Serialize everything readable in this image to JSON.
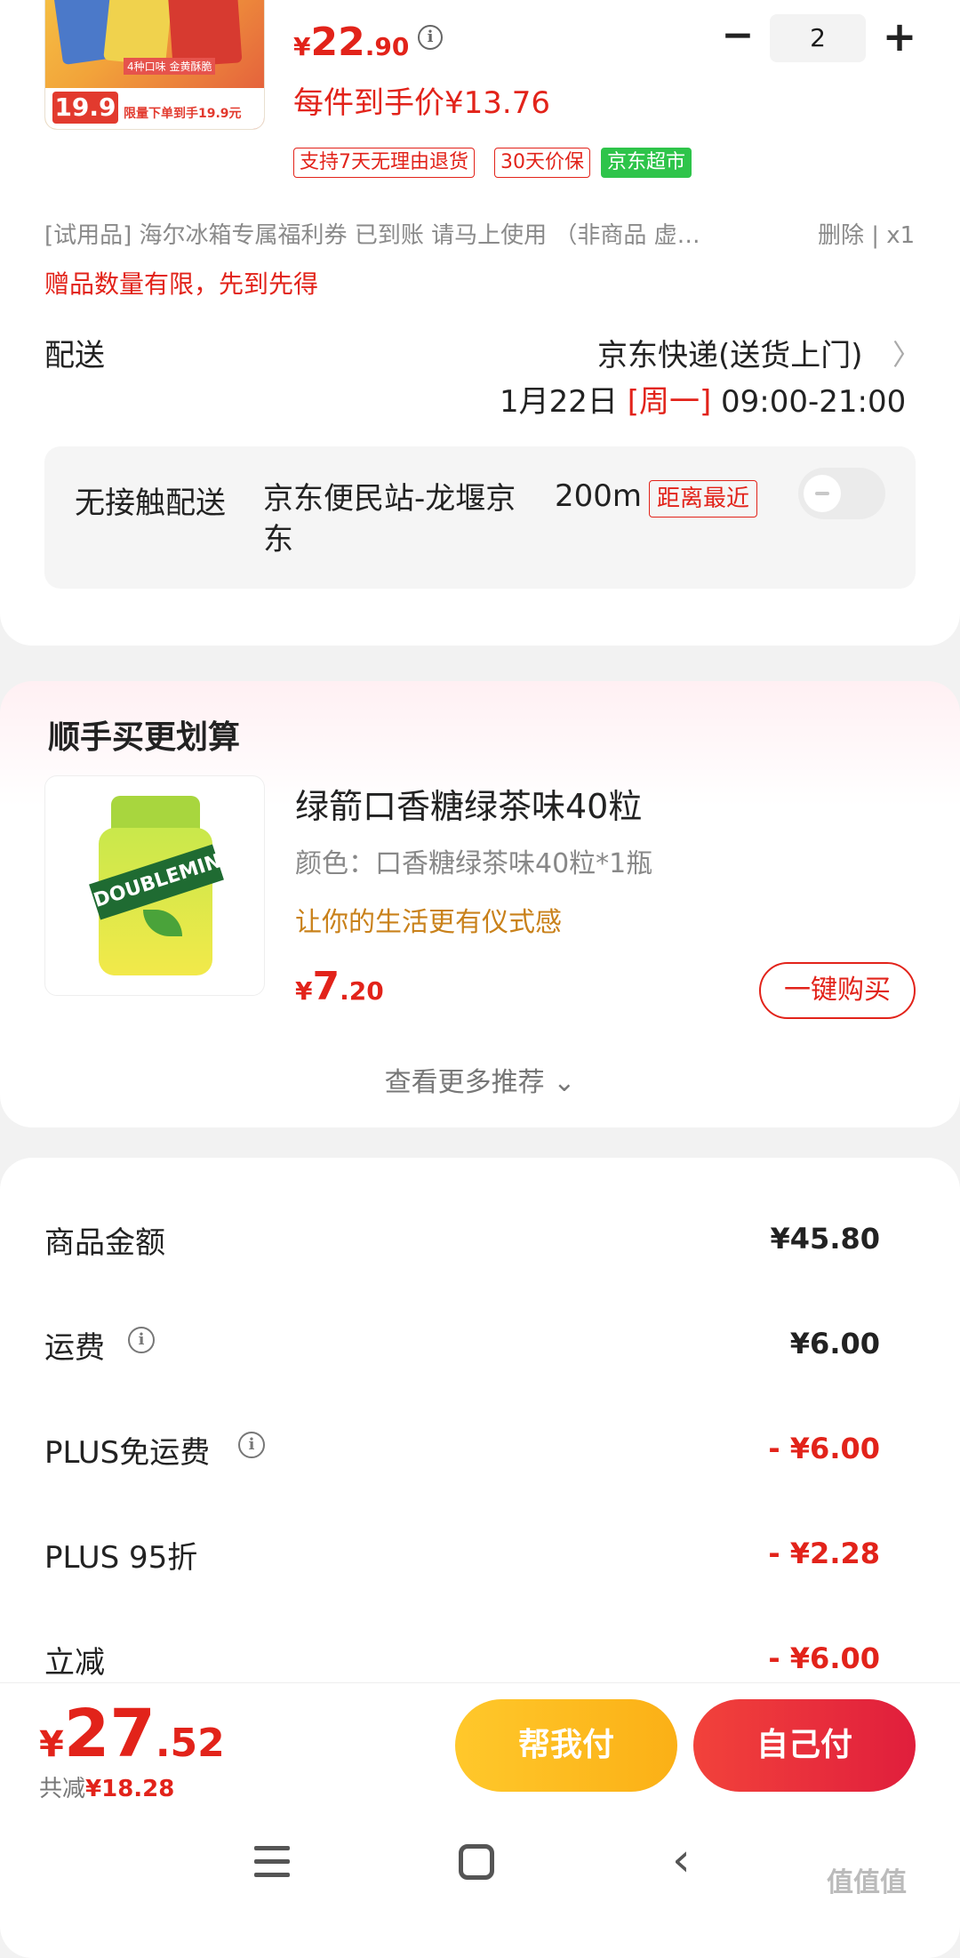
{
  "product": {
    "image_alt": "snack-pack",
    "image_price": "19.9",
    "image_promo": "限量下单到手19.9元",
    "image_strip": "4种口味 金黄酥脆",
    "price_yen": "¥",
    "price_int": "22",
    "price_dec": ".90",
    "unit_price": "每件到手价¥13.76",
    "quantity": "2",
    "tags": [
      "支持7天无理由退货",
      "30天价保",
      "京东超市"
    ]
  },
  "gift": {
    "line": "[试用品]  海尔冰箱专属福利券 已到账  请马上使用 （非商品 虚…",
    "delete": "删除 | x1",
    "note": "赠品数量有限，先到先得"
  },
  "delivery": {
    "label": "配送",
    "method": "京东快递(送货上门)",
    "date": "1月22日 ",
    "weekday": "[周一]",
    "time": " 09:00-21:00"
  },
  "contactless": {
    "title": "无接触配送",
    "station": "京东便民站-龙堰京东",
    "distance": "200m",
    "tag": "距离最近"
  },
  "recommend": {
    "title": "顺手买更划算",
    "item_name": "绿箭口香糖绿茶味40粒",
    "item_spec": "颜色：口香糖绿茶味40粒*1瓶",
    "slogan": "让你的生活更有仪式感",
    "price_yen": "¥",
    "price_int": "7",
    "price_dec": ".20",
    "buy_label": "一键购买",
    "more_label": "查看更多推荐 ⌄",
    "gum_brand": "DOUBLEMINT"
  },
  "summary": {
    "rows": [
      {
        "label": "商品金额",
        "value": "¥45.80"
      },
      {
        "label": "运费",
        "value": "¥6.00"
      },
      {
        "label": "PLUS免运费",
        "value": "- ¥6.00"
      },
      {
        "label": "PLUS 95折",
        "value": "- ¥2.28"
      },
      {
        "label": "立减",
        "value": "- ¥6.00"
      }
    ]
  },
  "checkout": {
    "total_yen": "¥",
    "total_int": "27",
    "total_dec": ".52",
    "saved_label": "共减",
    "saved_amount": "¥18.28",
    "help_pay": "帮我付",
    "self_pay": "自己付"
  },
  "watermark": "值值值",
  "colors": {
    "accent_red": "#e2231a",
    "accent_yellow": "#ffc82b",
    "green_tag": "#2ec44a"
  }
}
